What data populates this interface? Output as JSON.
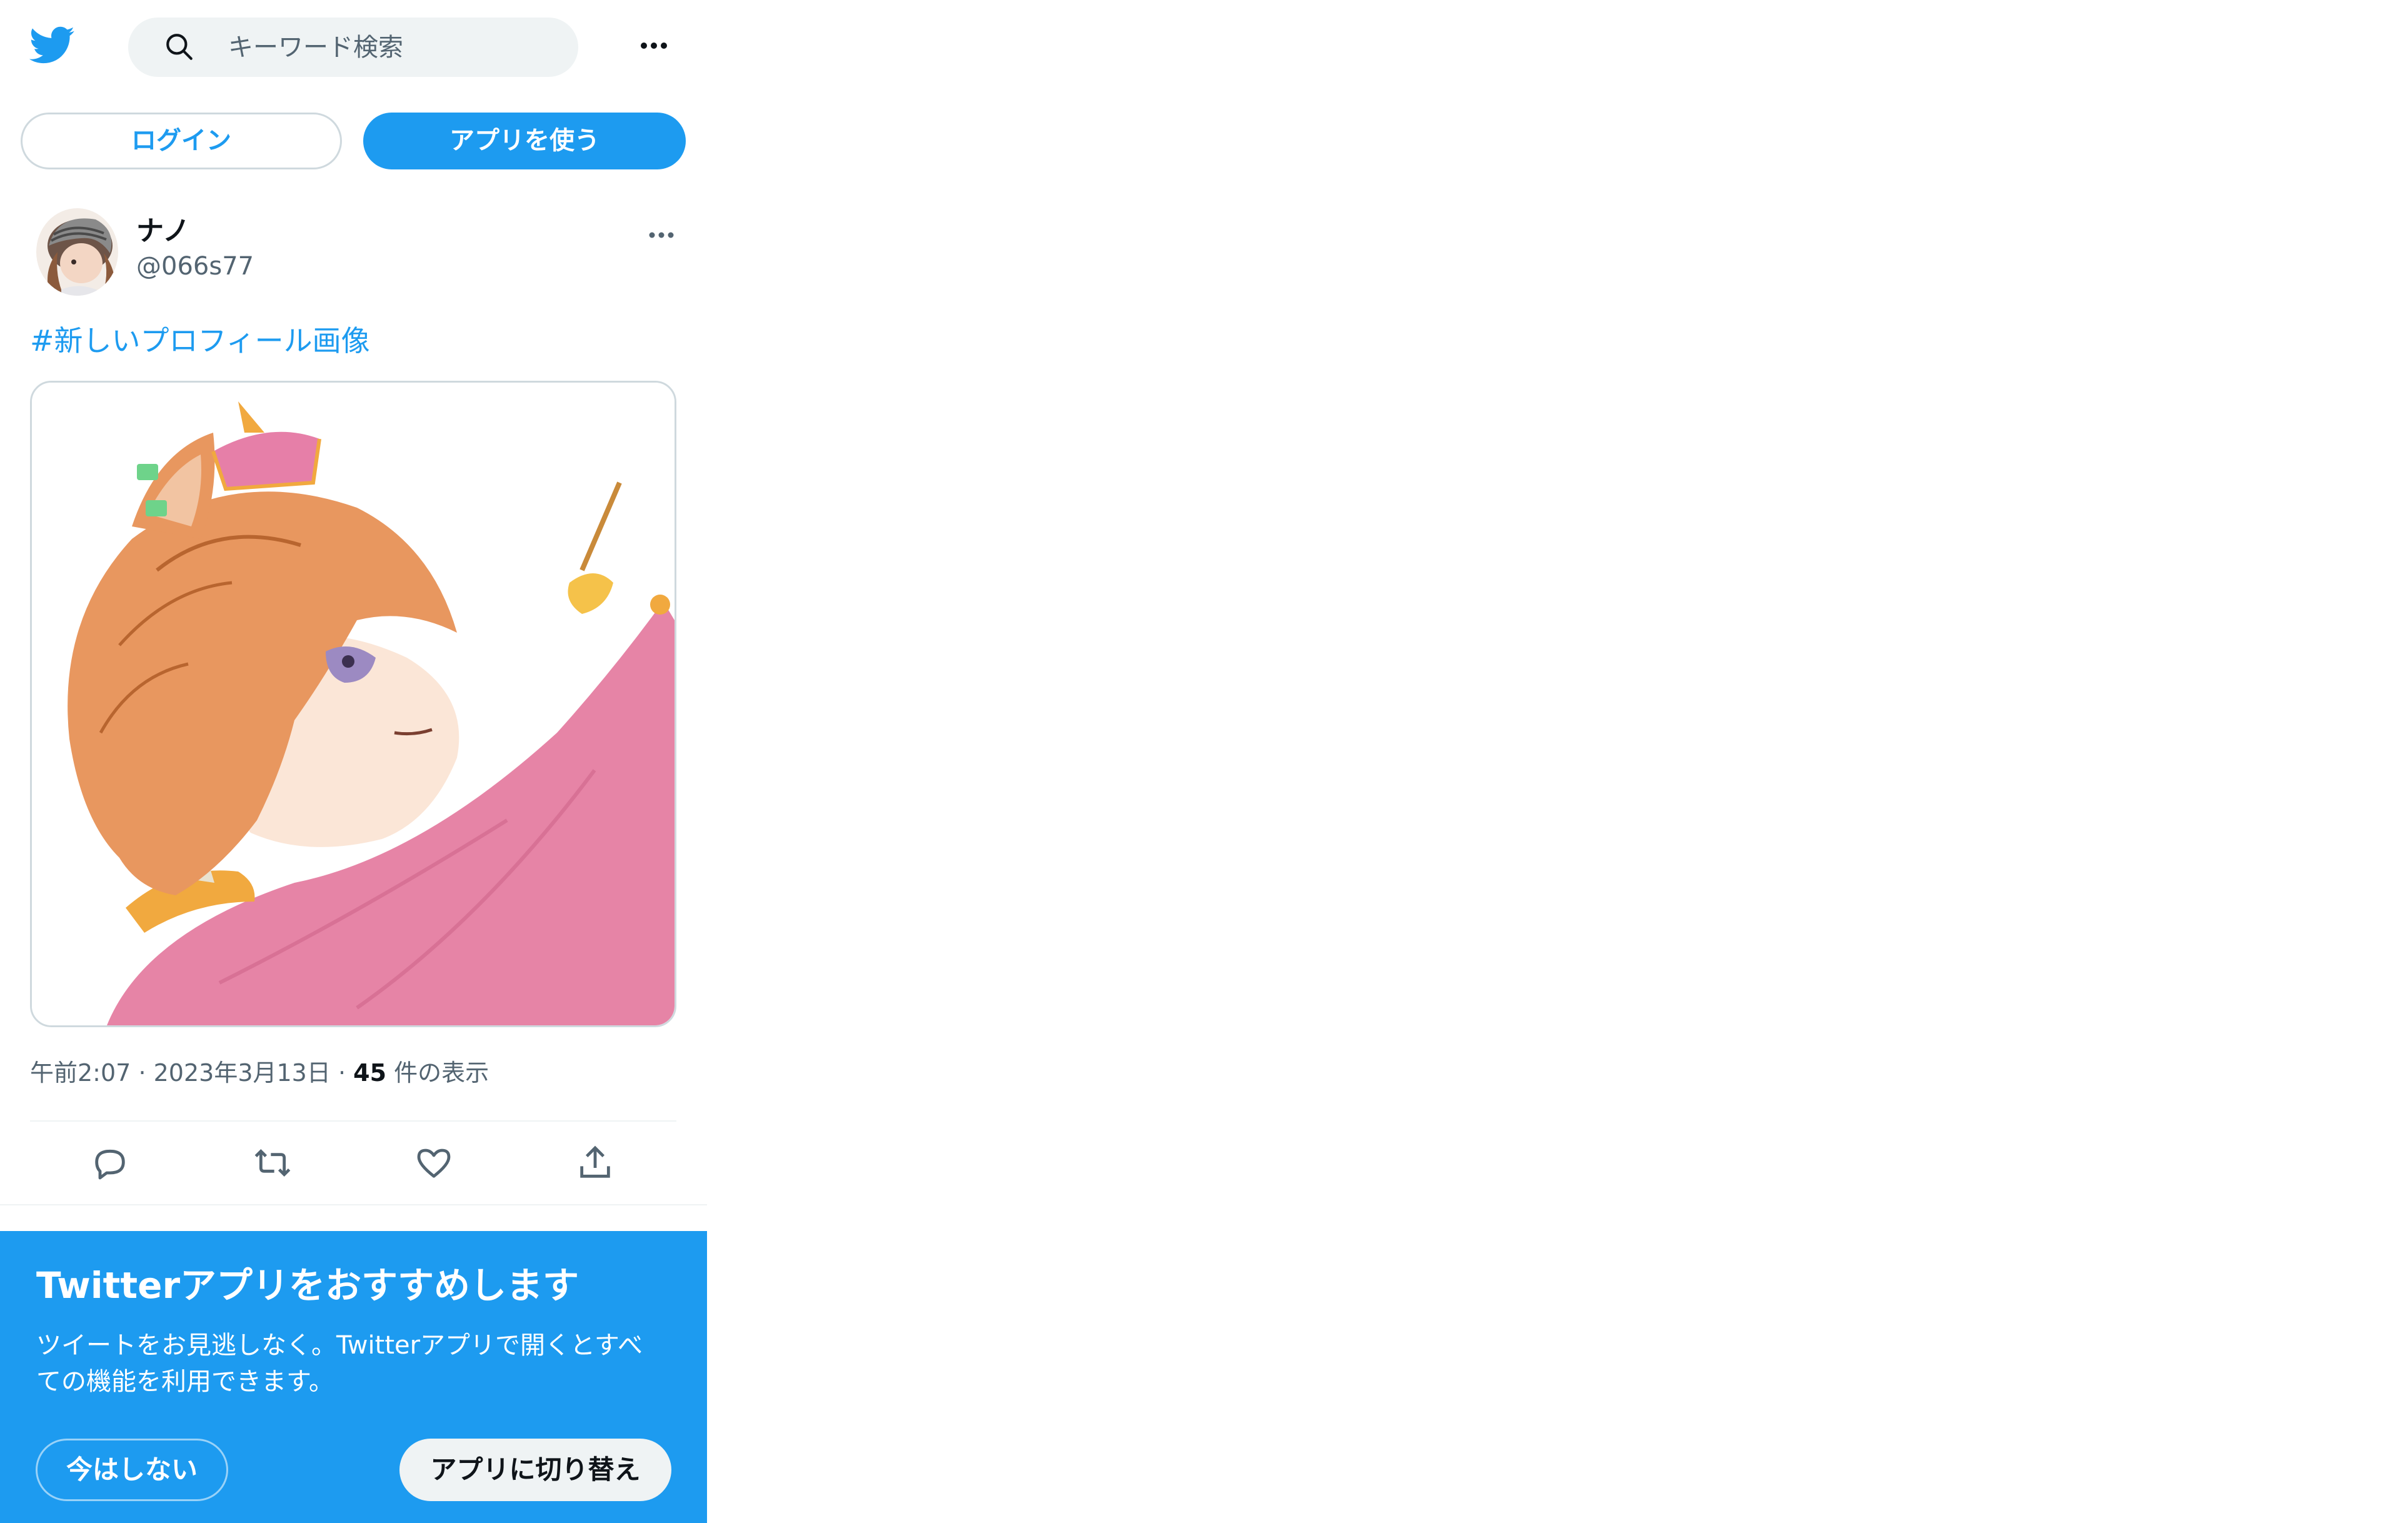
{
  "header": {
    "logo_icon": "twitter-bird-icon",
    "search_placeholder": "キーワード検索",
    "more_icon": "more-horizontal-icon"
  },
  "auth": {
    "login_label": "ログイン",
    "use_app_label": "アプリを使う"
  },
  "tweet": {
    "author_name": "ナノ",
    "author_handle": "@066s77",
    "hashtag": "#新しいプロフィール画像",
    "time": "午前2:07",
    "date": "2023年3月13日",
    "views_count": "45",
    "views_label": "件の表示",
    "separator": "·",
    "actions": [
      "reply-icon",
      "retweet-icon",
      "like-icon",
      "share-icon"
    ]
  },
  "banner": {
    "title": "Twitterアプリをおすすめします",
    "body_line1": "ツイートをお見逃しなく。Twitterアプリで開くとすべ",
    "body_line2": "ての機能を利用できます。",
    "not_now_label": "今はしない",
    "switch_label": "アプリに切り替え"
  },
  "colors": {
    "accent": "#1d9bf0",
    "text_primary": "#0f1419",
    "text_secondary": "#536471",
    "border": "#cfd9de"
  }
}
